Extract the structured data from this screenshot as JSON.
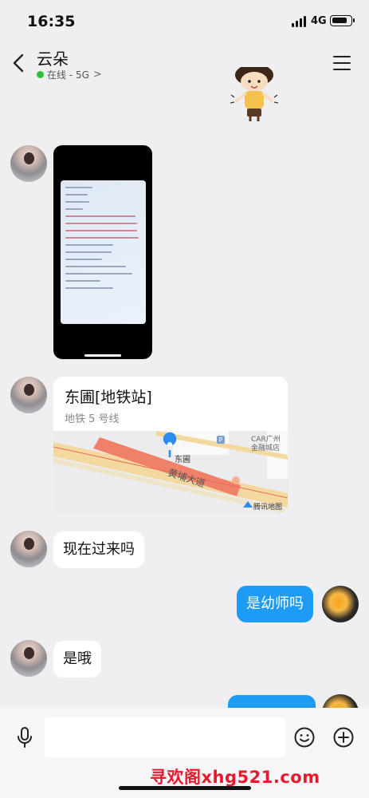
{
  "status_bar": {
    "time": "16:35",
    "network": "4G"
  },
  "header": {
    "contact_name": "云朵",
    "presence": "在线 - 5G",
    "presence_chevron": ">"
  },
  "messages": {
    "location": {
      "title": "东圃[地铁站]",
      "subtitle": "地铁 5 号线"
    },
    "map": {
      "label_station": "东圃",
      "label_road": "黄埔大道",
      "label_poi": "CAR广州",
      "label_poi2": "金融城店",
      "label_brand": "腾讯地图"
    },
    "m1": "现在过来吗",
    "m2": "是幼师吗",
    "m3": "是哦"
  },
  "input": {
    "placeholder": ""
  },
  "watermark": "寻欢阁xhg521.com",
  "colors": {
    "self_bubble": "#1d9bf5",
    "online_dot": "#27c13a",
    "background": "#efeff1",
    "watermark": "#e8192c"
  }
}
